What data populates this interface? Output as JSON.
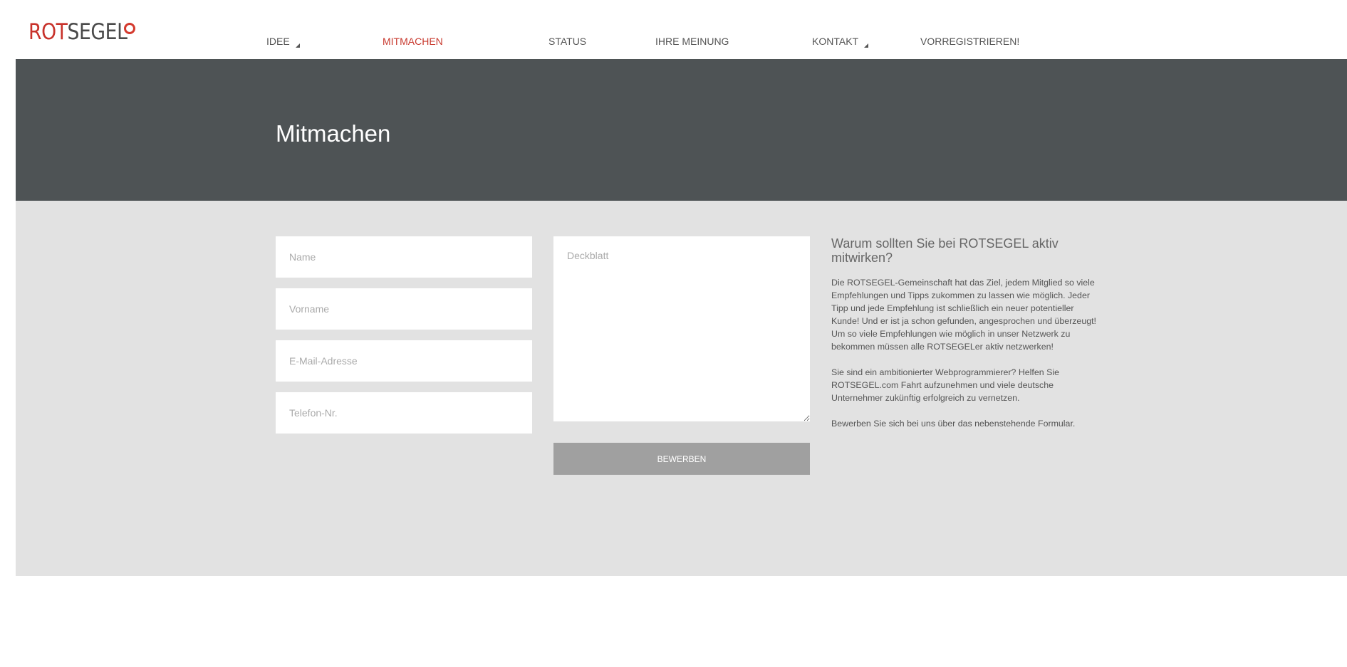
{
  "logo": {
    "part1": "ROT",
    "part2": "SEGEL"
  },
  "nav": {
    "items": [
      {
        "label": "IDEE",
        "dropdown": true
      },
      {
        "label": "MITMACHEN",
        "active": true
      },
      {
        "label": "STATUS"
      },
      {
        "label": "IHRE MEINUNG"
      },
      {
        "label": "KONTAKT",
        "dropdown": true
      },
      {
        "label": "VORREGISTRIEREN!"
      }
    ]
  },
  "page": {
    "title": "Mitmachen"
  },
  "form": {
    "name_placeholder": "Name",
    "vorname_placeholder": "Vorname",
    "email_placeholder": "E-Mail-Adresse",
    "phone_placeholder": "Telefon-Nr.",
    "deckblatt_placeholder": "Deckblatt",
    "submit_label": "BEWERBEN"
  },
  "sidebar": {
    "title": "Warum sollten Sie bei ROTSEGEL aktiv mitwirken?",
    "paragraphs": [
      "Die ROTSEGEL-Gemeinschaft hat das Ziel, jedem Mitglied so viele Empfehlungen und Tipps zukommen zu lassen wie möglich. Jeder Tipp und jede Empfehlung ist schließlich ein neuer potentieller Kunde! Und er ist ja schon gefunden, angesprochen und überzeugt! Um so viele Empfehlungen wie möglich in unser Netzwerk zu bekommen müssen alle ROTSEGELer aktiv netzwerken!",
      "Sie sind ein ambitionierter Webprogrammierer? Helfen Sie ROTSEGEL.com Fahrt aufzunehmen und viele deutsche Unternehmer zukünftig erfolgreich zu vernetzen.",
      "Bewerben Sie sich bei uns über das nebenstehende Formular."
    ]
  },
  "colors": {
    "brand_red": "#c8322b",
    "banner": "#4e5355",
    "content_bg": "#e2e2e2",
    "button": "#a0a0a0"
  }
}
